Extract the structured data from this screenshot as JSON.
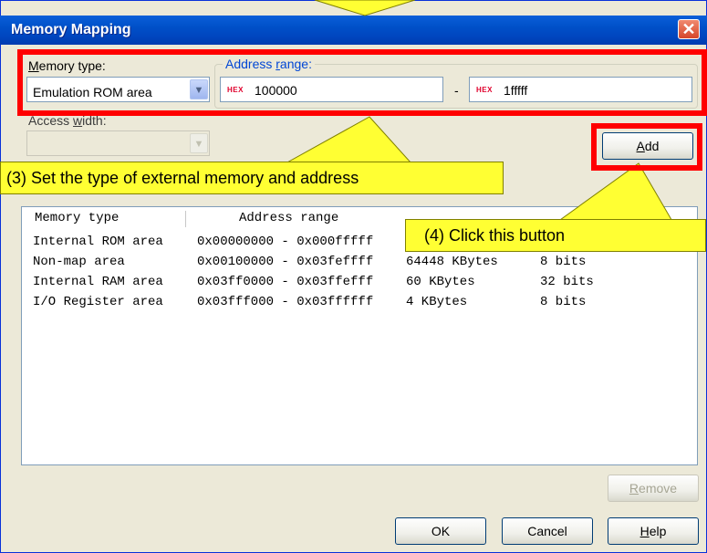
{
  "dialog": {
    "title": "Memory Mapping",
    "close_glyph": "✕"
  },
  "memory_type": {
    "label_prefix": "",
    "label_mnemonic": "M",
    "label_rest": "emory type:",
    "selected": "Emulation ROM area"
  },
  "address_range": {
    "label_prefix": "Address ",
    "label_mnemonic": "r",
    "label_rest": "ange:",
    "hex_tag": "HEX",
    "start_value": "100000",
    "separator": "-",
    "end_value": "1fffff"
  },
  "access_width": {
    "label_prefix": "Access ",
    "label_mnemonic": "w",
    "label_rest": "idth:",
    "selected": ""
  },
  "buttons": {
    "add": {
      "mnemonic": "A",
      "rest": "dd"
    },
    "remove": {
      "mnemonic": "R",
      "rest": "emove"
    },
    "ok": "OK",
    "cancel": "Cancel",
    "help": {
      "mnemonic": "H",
      "rest": "elp"
    }
  },
  "table": {
    "headers": [
      "Memory type",
      "Address range"
    ],
    "rows": [
      {
        "type": "Internal ROM area",
        "range": "0x00000000 - 0x000fffff",
        "size": "",
        "width": ""
      },
      {
        "type": "Non-map area",
        "range": "0x00100000 - 0x03feffff",
        "size": "64448 KBytes",
        "width": "8 bits"
      },
      {
        "type": "Internal RAM area",
        "range": "0x03ff0000 - 0x03ffefff",
        "size": "60 KBytes",
        "width": "32 bits"
      },
      {
        "type": "I/O Register area",
        "range": "0x03fff000 - 0x03ffffff",
        "size": "4 KBytes",
        "width": "8 bits"
      }
    ]
  },
  "callouts": {
    "step3": "(3) Set the type of external memory and address",
    "step4": "(4) Click this button"
  },
  "colors": {
    "highlight": "#ff0000",
    "callout_fill": "#ffff33",
    "titlebar": "#0050c8"
  }
}
